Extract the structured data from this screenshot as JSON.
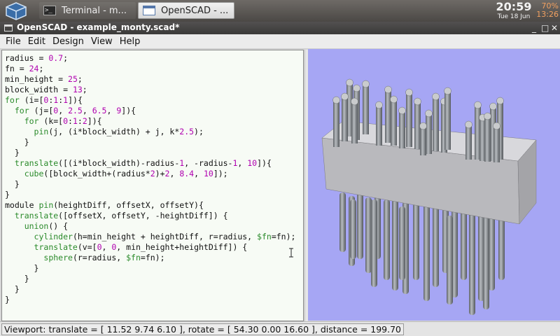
{
  "taskbar": {
    "tasks": [
      {
        "label": "Terminal - m..."
      },
      {
        "label": "OpenSCAD - ..."
      }
    ],
    "clock": {
      "time": "20:59",
      "date": "Tue 18 Jun"
    },
    "battery": {
      "percent": "70%",
      "time": "13:26"
    }
  },
  "window": {
    "title": "OpenSCAD - example_monty.scad*",
    "controls": {
      "minimize": "_",
      "maximize": "□",
      "close": "✕"
    }
  },
  "menu": [
    {
      "label": "File"
    },
    {
      "label": "Edit"
    },
    {
      "label": "Design"
    },
    {
      "label": "View"
    },
    {
      "label": "Help"
    }
  ],
  "editor": {
    "lines": [
      "radius = 0.7;",
      "fn = 24;",
      "min_height = 25;",
      "block_width = 13;",
      "for (i=[0:1:1]){",
      "  for (j=[0, 2.5, 6.5, 9]){",
      "    for (k=[0:1:2]){",
      "      pin(j, (i*block_width) + j, k*2.5);",
      "    }",
      "  }",
      "  translate([(i*block_width)-radius-1, -radius-1, 10]){",
      "    cube([block_width+(radius*2)+2, 8.4, 10]);",
      "  }",
      "}",
      "module pin(heightDiff, offsetX, offsetY){",
      "  translate([offsetX, offsetY, -heightDiff]) {",
      "    union() {",
      "      cylinder(h=min_height + heightDiff, r=radius, $fn=fn);",
      "      translate(v=[0, 0, min_height+heightDiff]) {",
      "        sphere(r=radius, $fn=fn);",
      "      }",
      "    }",
      "  }",
      "}"
    ]
  },
  "status": {
    "viewport": "Viewport: translate = [ 11.52 9.74 6.10 ], rotate = [ 54.30 0.00 16.60 ], distance = 199.70"
  },
  "colors": {
    "viewport_bg": "#a6a6f4",
    "model": "#8e9296",
    "editor_bg": "#f7fbf5",
    "keyword": "#2a8a2a",
    "number": "#b000b0"
  }
}
